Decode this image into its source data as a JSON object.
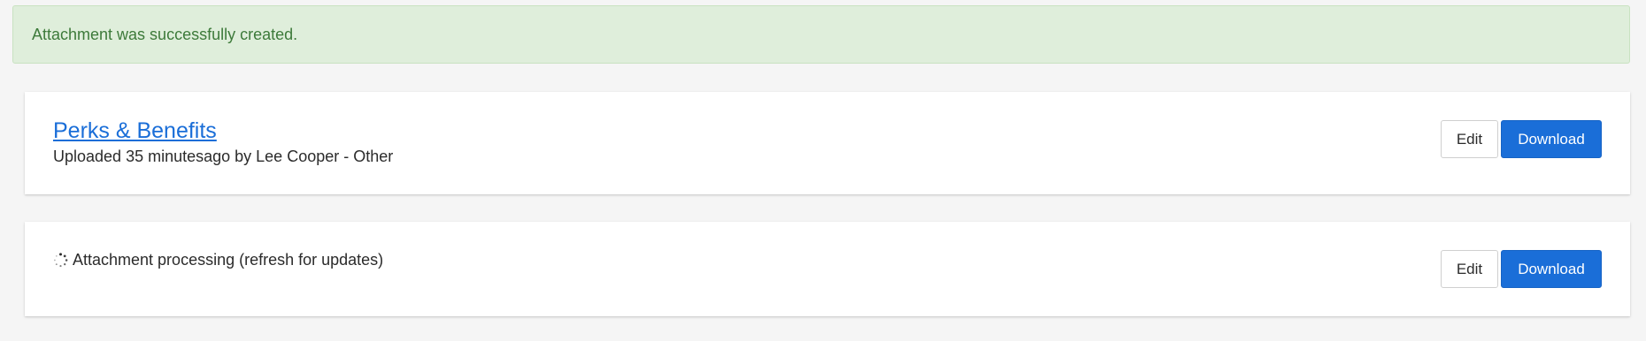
{
  "alert": {
    "message": "Attachment was successfully created.",
    "color": "#3d7a3a",
    "background": "#dfeedb"
  },
  "attachments": [
    {
      "title": "Perks & Benefits",
      "meta": "Uploaded 35 minutesago by Lee Cooper - Other",
      "edit_label": "Edit",
      "download_label": "Download"
    },
    {
      "status": "Attachment processing (refresh for updates)",
      "status_icon": "spinner-icon",
      "edit_label": "Edit",
      "download_label": "Download"
    }
  ],
  "colors": {
    "accent": "#1a6ed8",
    "page_background": "#f5f5f5"
  }
}
